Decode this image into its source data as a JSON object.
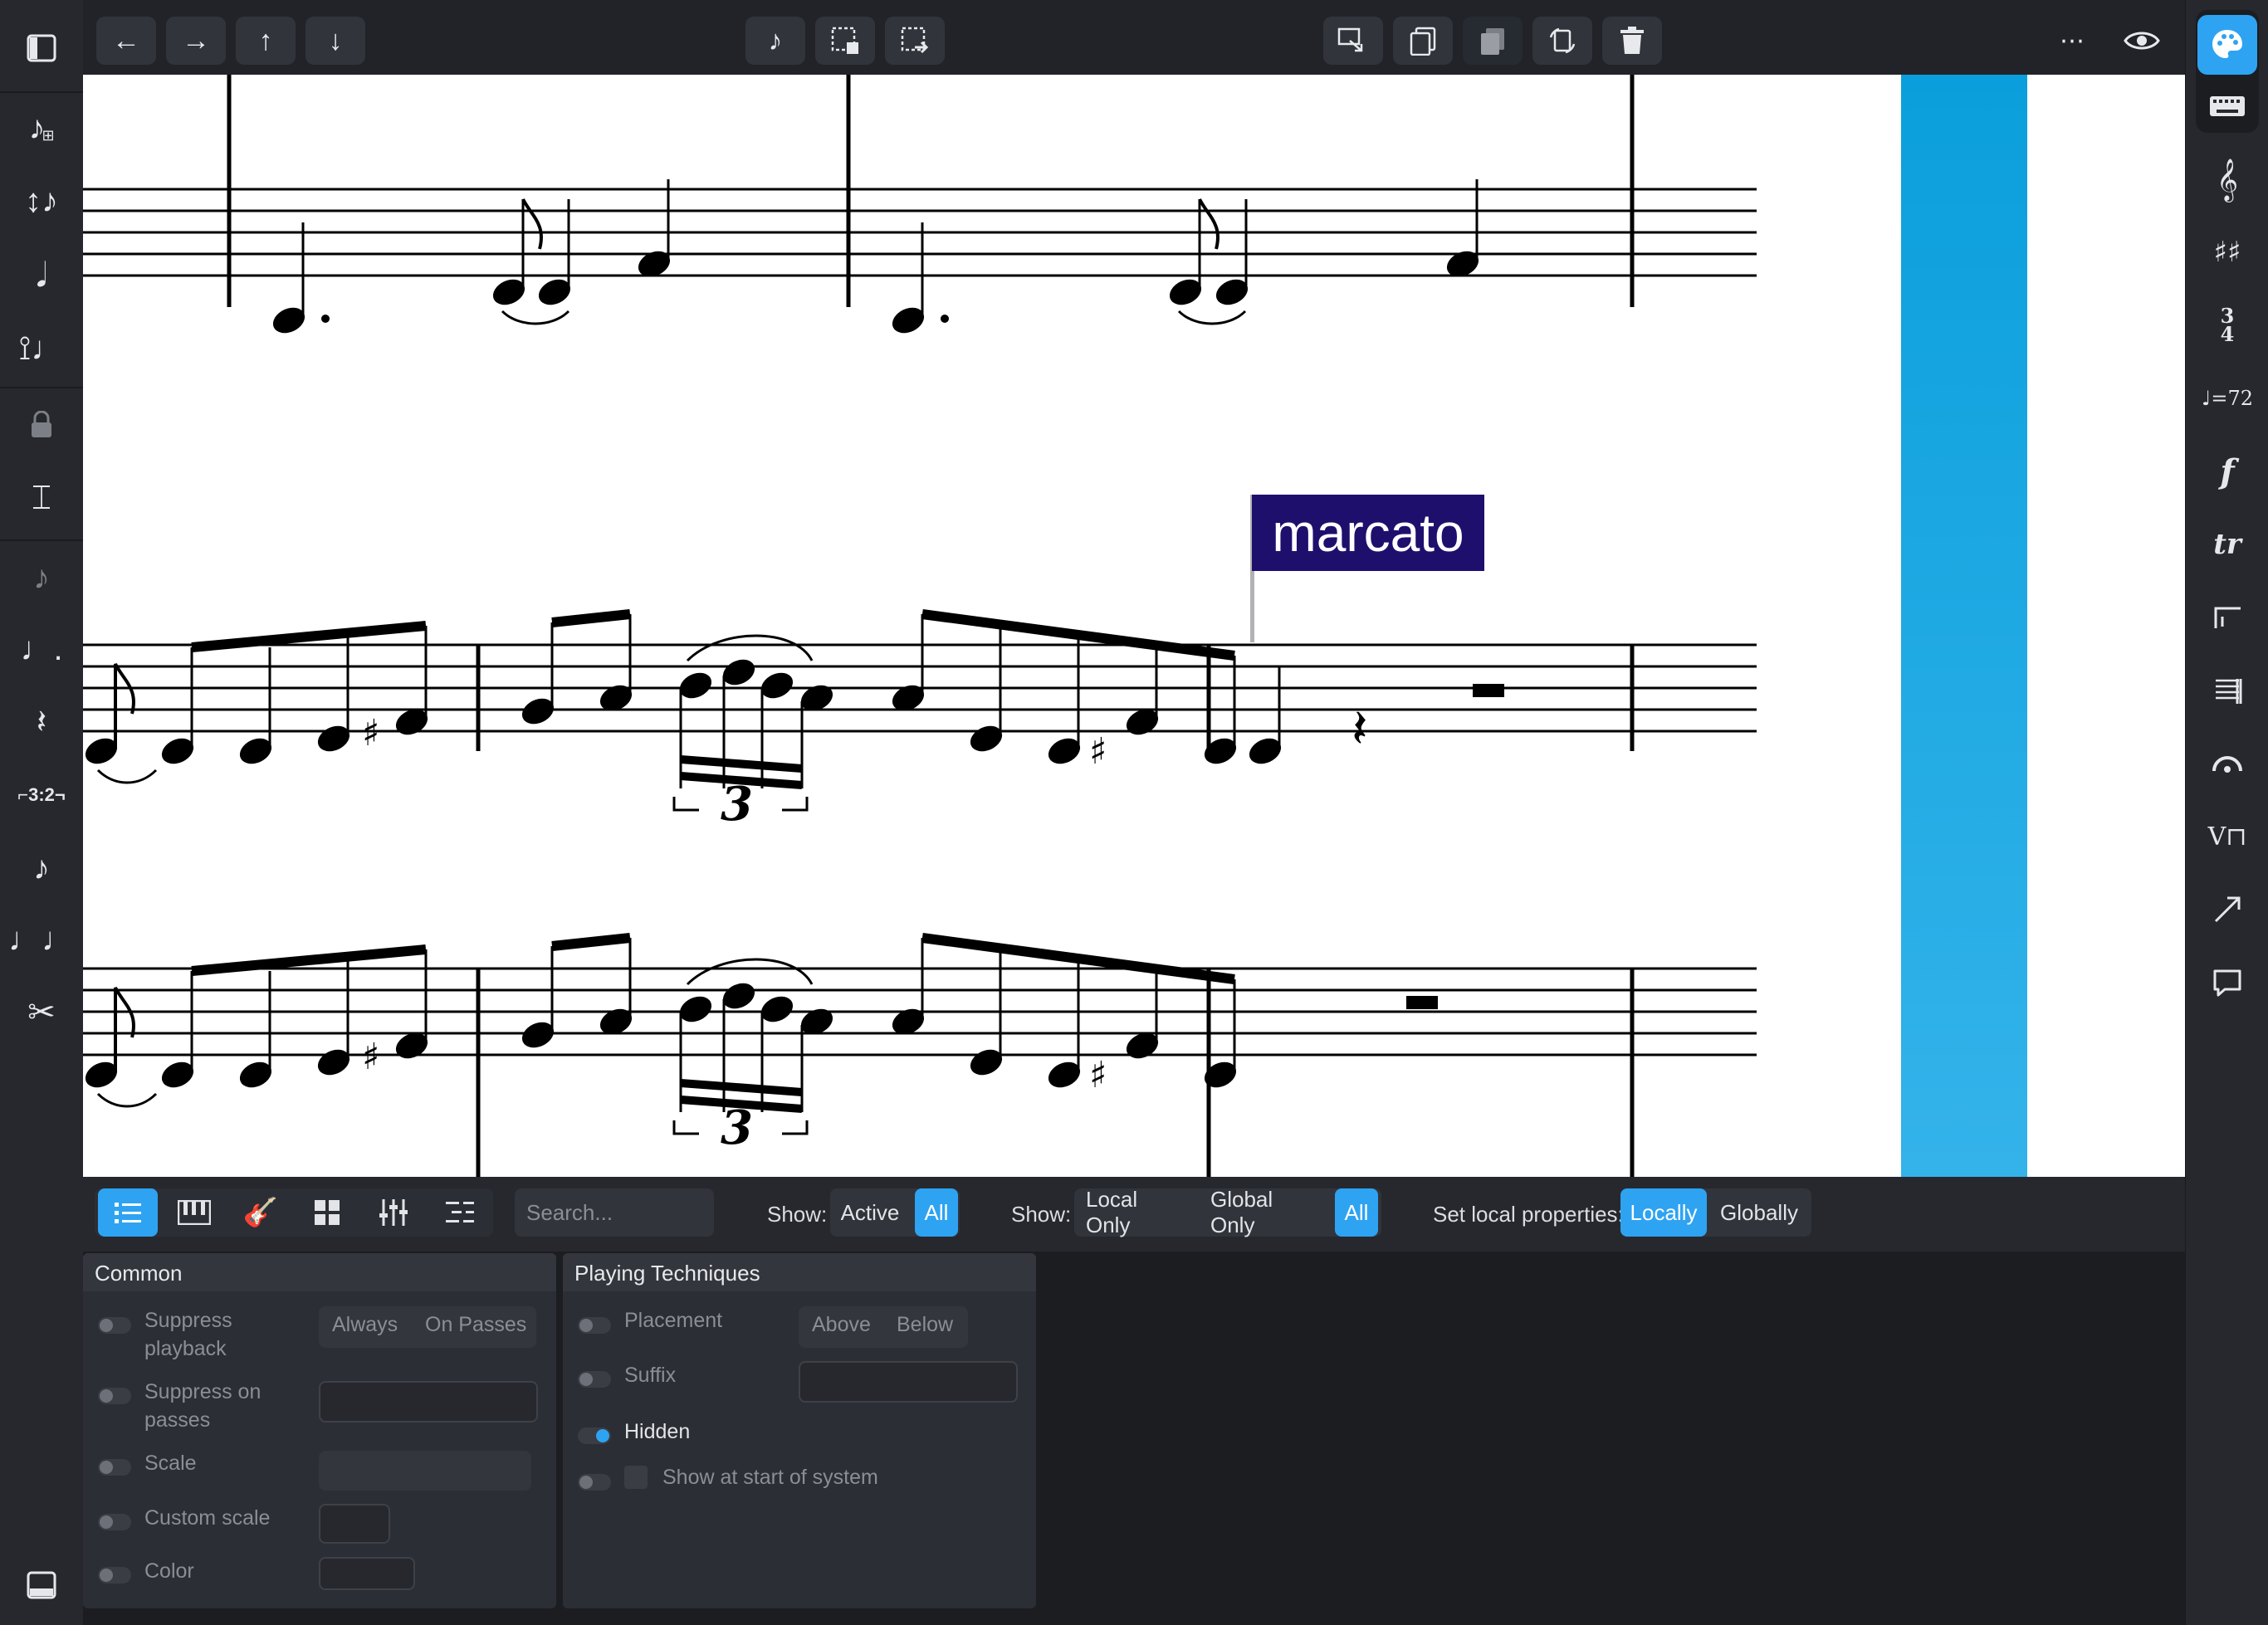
{
  "toolbar": {
    "nav": [
      "←",
      "→",
      "↑",
      "↓"
    ],
    "more_icon": "⋯",
    "eye_icon": "eye-icon"
  },
  "score": {
    "marcato_label": "marcato",
    "tuplet_number": "3"
  },
  "left_rail": {
    "tuplet_label": "⌐3:2¬"
  },
  "right_rail": {
    "tempo_label": "♩=72",
    "time_sig_top": "3",
    "time_sig_bottom": "4",
    "dynamic_label": "f",
    "ornament_label": "tr"
  },
  "lower_bar": {
    "search_placeholder": "Search...",
    "show1_label": "Show:",
    "show1_options": [
      "Active",
      "All"
    ],
    "show2_label": "Show:",
    "show2_options": [
      "Local Only",
      "Global Only",
      "All"
    ],
    "set_local_label": "Set local properties:",
    "set_local_options": [
      "Locally",
      "Globally"
    ]
  },
  "panels": {
    "common": {
      "title": "Common",
      "suppress_playback": "Suppress\nplayback",
      "suppress_options": [
        "Always",
        "On Passes"
      ],
      "suppress_on_passes": "Suppress on\npasses",
      "scale": "Scale",
      "custom_scale": "Custom scale",
      "color": "Color"
    },
    "playing_techniques": {
      "title": "Playing Techniques",
      "placement": "Placement",
      "placement_options": [
        "Above",
        "Below"
      ],
      "suffix": "Suffix",
      "hidden": "Hidden",
      "show_at_start": "Show at start of system"
    }
  },
  "colors": {
    "accent": "#2ea3f2",
    "marcato_bg": "#1f0f6d",
    "cyan_band": "#0aa0dc"
  }
}
